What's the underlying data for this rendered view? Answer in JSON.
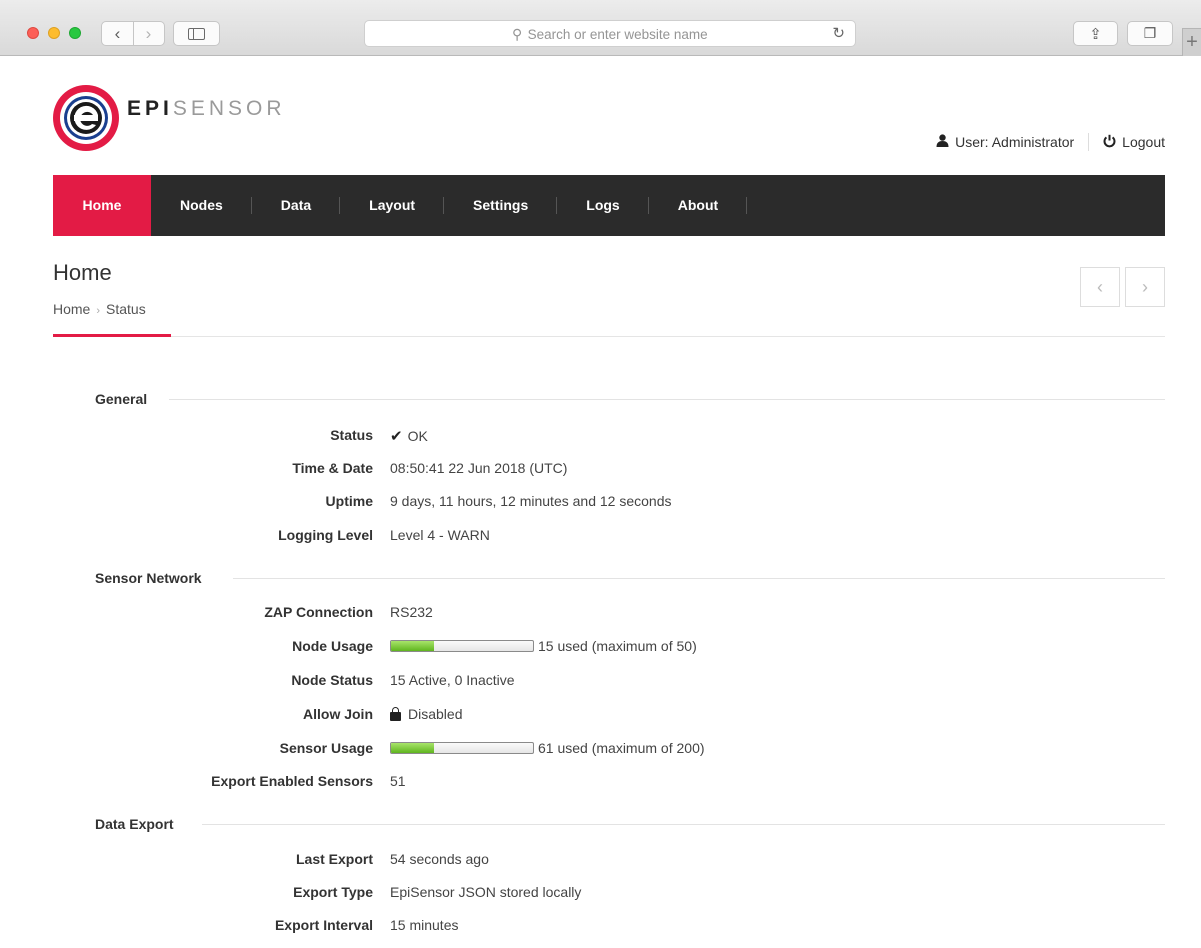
{
  "browser": {
    "address_placeholder": "Search or enter website name"
  },
  "logo": {
    "part1": "EPI",
    "part2": "SENSOR"
  },
  "user": {
    "label": "User: Administrator",
    "logout": "Logout"
  },
  "nav": [
    {
      "label": "Home",
      "active": true
    },
    {
      "label": "Nodes"
    },
    {
      "label": "Data"
    },
    {
      "label": "Layout"
    },
    {
      "label": "Settings"
    },
    {
      "label": "Logs"
    },
    {
      "label": "About"
    }
  ],
  "page": {
    "title": "Home",
    "breadcrumb": [
      "Home",
      "Status"
    ]
  },
  "sections": {
    "general": {
      "title": "General",
      "rows": [
        {
          "label": "Status",
          "value": "OK"
        },
        {
          "label": "Time & Date",
          "value": "08:50:41 22 Jun 2018 (UTC)"
        },
        {
          "label": "Uptime",
          "value": "9 days, 11 hours, 12 minutes and 12 seconds"
        },
        {
          "label": "Logging Level",
          "value": "Level 4 - WARN"
        }
      ]
    },
    "sensor_network": {
      "title": "Sensor Network",
      "rows": [
        {
          "label": "ZAP Connection",
          "value": "RS232"
        },
        {
          "label": "Node Usage",
          "value": "15 used (maximum of 50)",
          "progress": 0.3
        },
        {
          "label": "Node Status",
          "value": "15 Active, 0 Inactive"
        },
        {
          "label": "Allow Join",
          "value": "Disabled"
        },
        {
          "label": "Sensor Usage",
          "value": "61 used (maximum of 200)",
          "progress": 0.305
        },
        {
          "label": "Export Enabled Sensors",
          "value": "51"
        }
      ]
    },
    "data_export": {
      "title": "Data Export",
      "rows": [
        {
          "label": "Last Export",
          "value": "54 seconds ago"
        },
        {
          "label": "Export Type",
          "value": "EpiSensor JSON stored locally"
        },
        {
          "label": "Export Interval",
          "value": "15 minutes"
        }
      ]
    }
  },
  "colors": {
    "accent": "#e31b45",
    "navbar": "#2b2b2b",
    "progress_fill": "#7ccc35"
  }
}
